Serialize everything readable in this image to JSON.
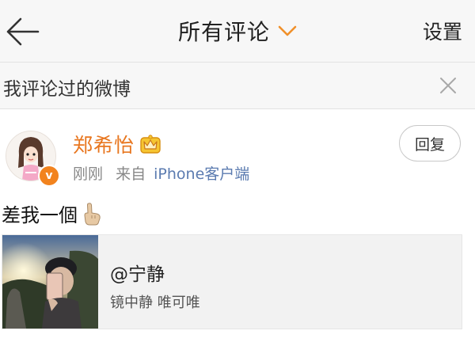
{
  "nav": {
    "title": "所有评论",
    "settings_label": "设置",
    "back_icon": "arrow-left-icon",
    "dropdown_icon": "chevron-down-icon",
    "accent": "#f0902a"
  },
  "filter": {
    "label": "我评论过的微博",
    "clear_icon": "close-icon"
  },
  "comment": {
    "username": "郑希怡",
    "username_color": "#e8761f",
    "badge_icon": "crown-icon",
    "verified_icon": "verified-v-icon",
    "verified_label": "v",
    "time": "刚刚",
    "source_prefix": "来自",
    "source": "iPhone客户端",
    "reply_label": "回复",
    "text": "差我一個",
    "emoji_icon": "pointing-hand-icon"
  },
  "quoted": {
    "title": "@宁静",
    "description": "镜中静   唯可唯",
    "image_icon": "mirror-selfie-photo"
  }
}
